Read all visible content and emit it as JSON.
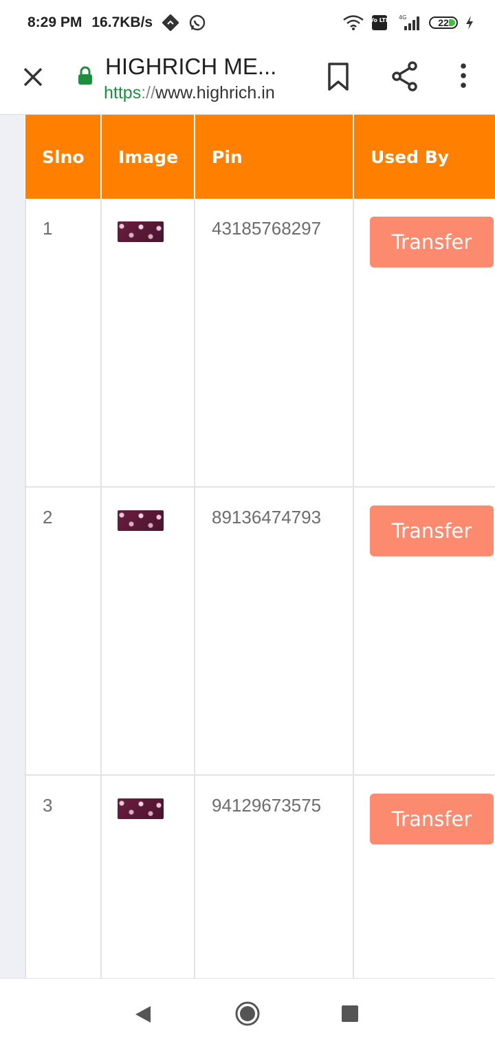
{
  "status_bar": {
    "time": "8:29 PM",
    "speed": "16.7KB/s",
    "network": "4G",
    "volte": "Vo LTE",
    "battery": "22"
  },
  "toolbar": {
    "title": "HIGHRICH ME...",
    "url_scheme": "https",
    "url_sep": "://",
    "url_host": "www.highrich.in"
  },
  "table": {
    "headers": [
      "Slno",
      "Image",
      "Pin",
      "Used By"
    ],
    "rows": [
      {
        "slno": "1",
        "pin": "43185768297",
        "action": "Transfer"
      },
      {
        "slno": "2",
        "pin": "89136474793",
        "action": "Transfer"
      },
      {
        "slno": "3",
        "pin": "94129673575",
        "action": "Transfer"
      }
    ]
  },
  "colors": {
    "header_bg": "#ff8000",
    "button_bg": "#fb8a6e",
    "page_bg": "#eef0f5"
  }
}
